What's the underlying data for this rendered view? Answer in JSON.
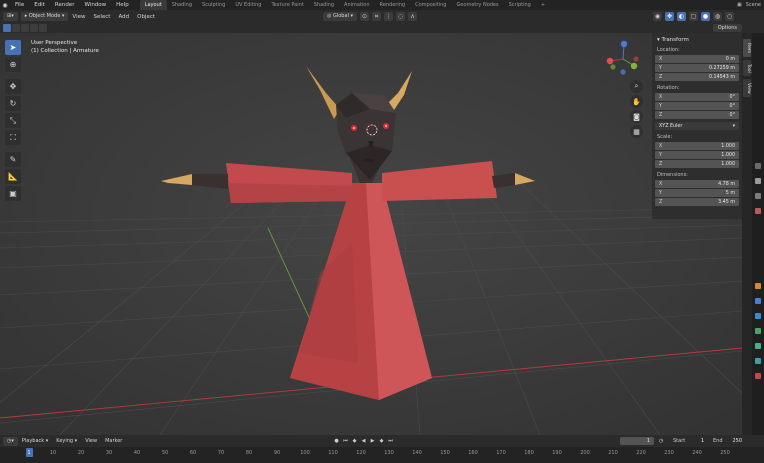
{
  "menu": [
    "File",
    "Edit",
    "Render",
    "Window",
    "Help"
  ],
  "workspaces": [
    "Layout",
    "Shading",
    "Sculpting",
    "UV Editing",
    "Texture Paint",
    "Shading",
    "Animation",
    "Rendering",
    "Compositing",
    "Geometry Nodes",
    "Scripting"
  ],
  "active_workspace": "Layout",
  "topbar_right": {
    "scene": "Scene"
  },
  "header": {
    "mode": "Object Mode",
    "menus": [
      "View",
      "Select",
      "Add",
      "Object"
    ],
    "transform_orientation": "Global",
    "options": "Options"
  },
  "viewport": {
    "perspective": "User Perspective",
    "collection": "(1) Collection | Armature"
  },
  "npanel": {
    "title": "Transform",
    "location_label": "Location:",
    "location": [
      [
        "X",
        "0 m"
      ],
      [
        "Y",
        "0.27259 m"
      ],
      [
        "Z",
        "0.14543 m"
      ]
    ],
    "rotation_label": "Rotation:",
    "rotation": [
      [
        "X",
        "0°"
      ],
      [
        "Y",
        "0°"
      ],
      [
        "Z",
        "0°"
      ]
    ],
    "rotation_mode": "XYZ Euler",
    "scale_label": "Scale:",
    "scale": [
      [
        "X",
        "1.000"
      ],
      [
        "Y",
        "1.000"
      ],
      [
        "Z",
        "1.000"
      ]
    ],
    "dimensions_label": "Dimensions:",
    "dimensions": [
      [
        "X",
        "4.78 m"
      ],
      [
        "Y",
        "5 m"
      ],
      [
        "Z",
        "3.45 m"
      ]
    ]
  },
  "sidetabs": [
    "Item",
    "Tool",
    "View"
  ],
  "timeline": {
    "menus": [
      "Playback",
      "Keying",
      "View",
      "Marker"
    ],
    "current_frame": "1",
    "start_label": "Start",
    "start": "1",
    "end_label": "End",
    "end": "250",
    "ticks": [
      "1",
      "10",
      "20",
      "30",
      "40",
      "50",
      "60",
      "70",
      "80",
      "90",
      "100",
      "110",
      "120",
      "130",
      "140",
      "150",
      "160",
      "170",
      "180",
      "190",
      "200",
      "210",
      "220",
      "230",
      "240",
      "250"
    ]
  },
  "colors": {
    "accent": "#4772b3",
    "robe": "#c1494c",
    "mask": "#3a3434",
    "horn": "#d6a860",
    "axis_x": "#b83b3b",
    "axis_y": "#6e9a3a"
  }
}
